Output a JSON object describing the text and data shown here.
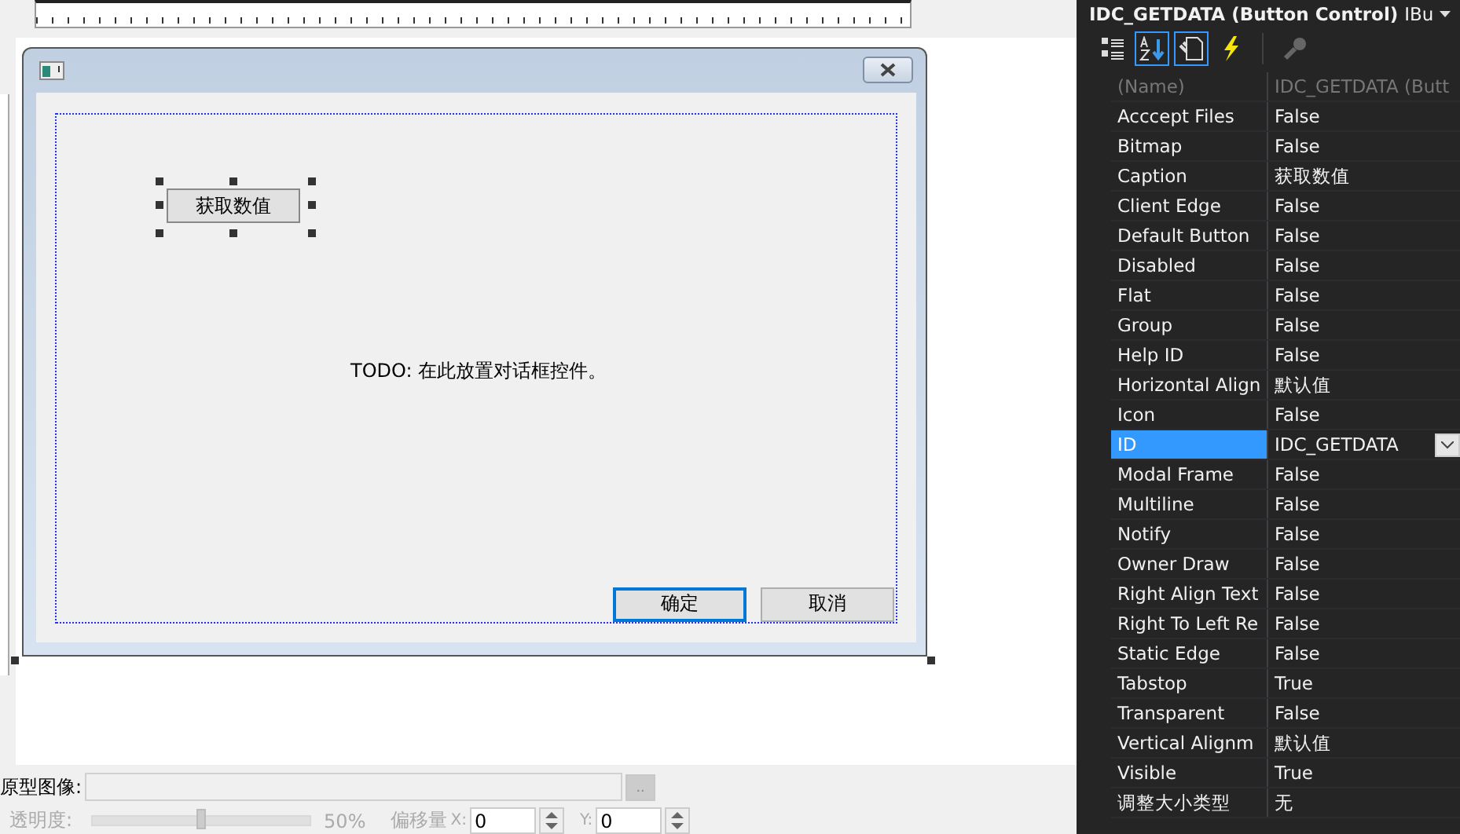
{
  "designer": {
    "dialog": {
      "controls": [
        {
          "label": "获取数值",
          "selected": true
        }
      ],
      "static_text": "TODO: 在此放置对话框控件。",
      "buttons": [
        {
          "label": "确定",
          "default": true
        },
        {
          "label": "取消",
          "default": false
        }
      ]
    }
  },
  "bottom_panel": {
    "image_label": "原型图像:",
    "browse_button": "..",
    "opacity_label": "透明度:",
    "opacity": {
      "level": 0.5,
      "reading": "50%"
    },
    "disabled": true,
    "offset_label": "偏移量",
    "x_label": "X:",
    "x_value": "0",
    "y_label": "Y:",
    "y_value": "0"
  },
  "properties": {
    "title": "IDC_GETDATA (Button Control)",
    "object": "IBu",
    "toolbar": [
      {
        "kind": "categorized",
        "selected": false,
        "disabled": false
      },
      {
        "kind": "alphabetical",
        "selected": true,
        "disabled": false
      },
      {
        "kind": "pages",
        "selected": true,
        "disabled": false
      },
      {
        "kind": "events",
        "selected": false,
        "disabled": false
      },
      {
        "kind": "key",
        "selected": false,
        "disabled": true
      }
    ],
    "rows": [
      {
        "name": "(Name)",
        "value": "IDC_GETDATA (Butt",
        "kind": "text",
        "selected": false,
        "disabled": true
      },
      {
        "name": "Acccept Files",
        "value": "False",
        "kind": "text",
        "selected": false,
        "disabled": false
      },
      {
        "name": "Bitmap",
        "value": "False",
        "kind": "text",
        "selected": false,
        "disabled": false
      },
      {
        "name": "Caption",
        "value": "获取数值",
        "kind": "text",
        "selected": false,
        "disabled": false
      },
      {
        "name": "Client Edge",
        "value": "False",
        "kind": "text",
        "selected": false,
        "disabled": false
      },
      {
        "name": "Default Button",
        "value": "False",
        "kind": "text",
        "selected": false,
        "disabled": false
      },
      {
        "name": "Disabled",
        "value": "False",
        "kind": "text",
        "selected": false,
        "disabled": false
      },
      {
        "name": "Flat",
        "value": "False",
        "kind": "text",
        "selected": false,
        "disabled": false
      },
      {
        "name": "Group",
        "value": "False",
        "kind": "text",
        "selected": false,
        "disabled": false
      },
      {
        "name": "Help ID",
        "value": "False",
        "kind": "text",
        "selected": false,
        "disabled": false
      },
      {
        "name": "Horizontal Align",
        "value": "默认值",
        "kind": "text",
        "selected": false,
        "disabled": false
      },
      {
        "name": "Icon",
        "value": "False",
        "kind": "text",
        "selected": false,
        "disabled": false
      },
      {
        "name": "ID",
        "value": "IDC_GETDATA",
        "kind": "combo",
        "selected": true,
        "disabled": false
      },
      {
        "name": "Modal Frame",
        "value": "False",
        "kind": "text",
        "selected": false,
        "disabled": false
      },
      {
        "name": "Multiline",
        "value": "False",
        "kind": "text",
        "selected": false,
        "disabled": false
      },
      {
        "name": "Notify",
        "value": "False",
        "kind": "text",
        "selected": false,
        "disabled": false
      },
      {
        "name": "Owner Draw",
        "value": "False",
        "kind": "text",
        "selected": false,
        "disabled": false
      },
      {
        "name": "Right Align Text",
        "value": "False",
        "kind": "text",
        "selected": false,
        "disabled": false
      },
      {
        "name": "Right To Left Re",
        "value": "False",
        "kind": "text",
        "selected": false,
        "disabled": false
      },
      {
        "name": "Static Edge",
        "value": "False",
        "kind": "text",
        "selected": false,
        "disabled": false
      },
      {
        "name": "Tabstop",
        "value": "True",
        "kind": "text",
        "selected": false,
        "disabled": false
      },
      {
        "name": "Transparent",
        "value": "False",
        "kind": "text",
        "selected": false,
        "disabled": false
      },
      {
        "name": "Vertical Alignm",
        "value": "默认值",
        "kind": "text",
        "selected": false,
        "disabled": false
      },
      {
        "name": "Visible",
        "value": "True",
        "kind": "text",
        "selected": false,
        "disabled": false
      },
      {
        "name": "调整大小类型",
        "value": "无",
        "kind": "text",
        "selected": false,
        "disabled": false
      }
    ]
  }
}
